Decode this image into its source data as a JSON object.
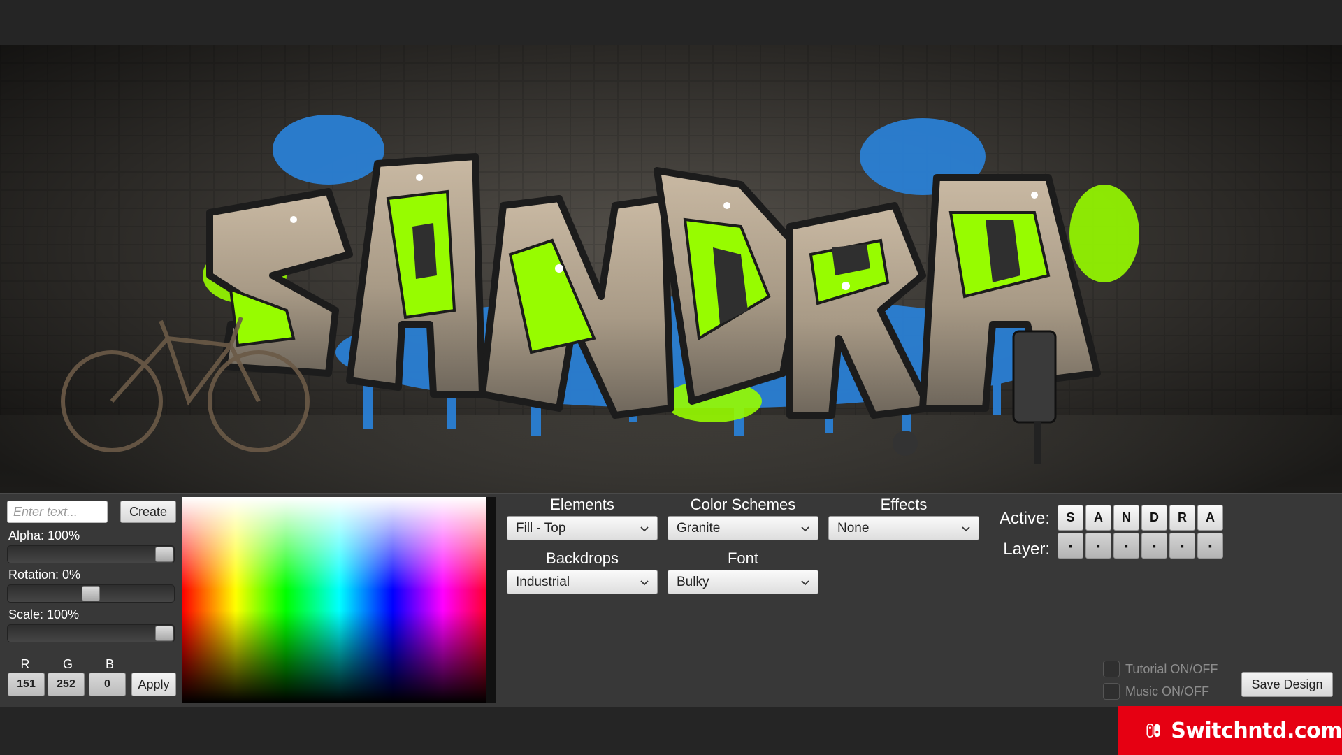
{
  "canvas": {
    "graffiti_text": "SANDRA",
    "fill_color": "#97fc00",
    "accent_color": "#2a7fd4"
  },
  "text_entry": {
    "placeholder": "Enter text...",
    "create_label": "Create"
  },
  "sliders": {
    "alpha": {
      "label": "Alpha: 100%",
      "value_percent": 100
    },
    "rotation": {
      "label": "Rotation: 0%",
      "value_percent": 0
    },
    "scale": {
      "label": "Scale: 100%",
      "value_percent": 100
    }
  },
  "rgb": {
    "r_label": "R",
    "g_label": "G",
    "b_label": "B",
    "r": "151",
    "g": "252",
    "b": "0",
    "apply_label": "Apply"
  },
  "dropdowns": {
    "elements": {
      "title": "Elements",
      "value": "Fill - Top"
    },
    "color_schemes": {
      "title": "Color Schemes",
      "value": "Granite"
    },
    "effects": {
      "title": "Effects",
      "value": "None"
    },
    "backdrops": {
      "title": "Backdrops",
      "value": "Industrial"
    },
    "font": {
      "title": "Font",
      "value": "Bulky"
    }
  },
  "letters": {
    "active_label": "Active:",
    "layer_label": "Layer:",
    "active": [
      "S",
      "A",
      "N",
      "D",
      "R",
      "A"
    ],
    "layer": [
      "▪",
      "▪",
      "▪",
      "▪",
      "▪",
      "▪"
    ]
  },
  "options": {
    "tutorial_label": "Tutorial ON/OFF",
    "music_label": "Music ON/OFF",
    "save_label": "Save Design"
  },
  "brand": {
    "text": "Switchntd.com",
    "color": "#e60012"
  }
}
